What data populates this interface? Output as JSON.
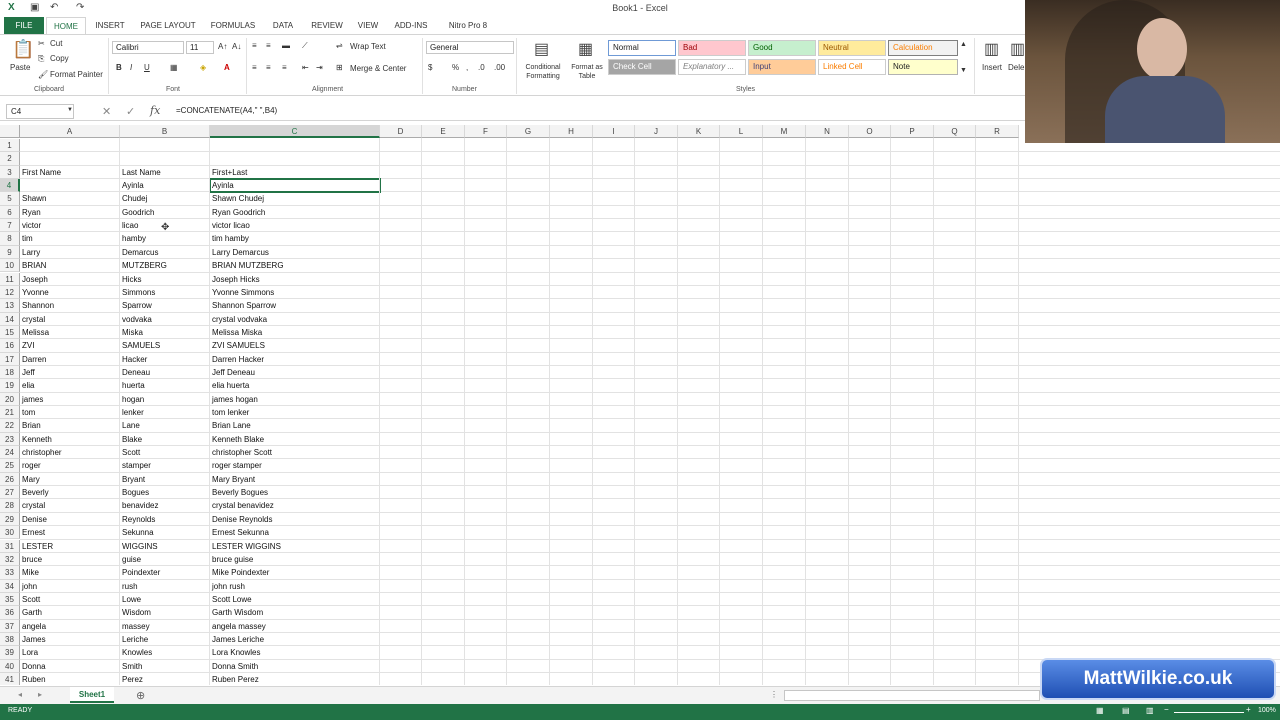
{
  "window": {
    "title": "Book1 - Excel"
  },
  "qat": {
    "excel_icon": "excel-icon",
    "save_icon": "save-icon",
    "undo_icon": "undo-icon",
    "redo_icon": "redo-icon"
  },
  "tabs": [
    "FILE",
    "HOME",
    "INSERT",
    "PAGE LAYOUT",
    "FORMULAS",
    "DATA",
    "REVIEW",
    "VIEW",
    "ADD-INS",
    "Nitro Pro 8"
  ],
  "ribbon": {
    "clipboard": {
      "paste": "Paste",
      "cut": "Cut",
      "copy": "Copy",
      "format_painter": "Format Painter",
      "label": "Clipboard"
    },
    "font": {
      "name": "Calibri",
      "size": "11",
      "bold": "B",
      "italic": "I",
      "underline": "U",
      "label": "Font"
    },
    "alignment": {
      "wrap_text": "Wrap Text",
      "merge_center": "Merge & Center",
      "label": "Alignment"
    },
    "number": {
      "format": "General",
      "percent": "%",
      "label": "Number"
    },
    "styles": {
      "conditional": "Conditional Formatting",
      "format_as_table": "Format as Table",
      "cells": [
        "Normal",
        "Bad",
        "Good",
        "Neutral",
        "Calculation",
        "Check Cell",
        "Explanatory ...",
        "Input",
        "Linked Cell",
        "Note"
      ],
      "label": "Styles"
    },
    "cells_group": {
      "insert": "Insert",
      "delete": "Dele"
    }
  },
  "formula_bar": {
    "name_box": "C4",
    "cancel": "✕",
    "enter": "✓",
    "fx": "fx",
    "formula": "=CONCATENATE(A4,\" \",B4)"
  },
  "columns": [
    "A",
    "B",
    "C",
    "D",
    "E",
    "F",
    "G",
    "H",
    "I",
    "J",
    "K",
    "L",
    "M",
    "N",
    "O",
    "P",
    "Q",
    "R"
  ],
  "rows": [
    {
      "n": "1",
      "a": "",
      "b": "",
      "c": ""
    },
    {
      "n": "2",
      "a": "",
      "b": "",
      "c": ""
    },
    {
      "n": "3",
      "a": "First Name",
      "b": "Last Name",
      "c": "First+Last"
    },
    {
      "n": "4",
      "a": "",
      "b": "Ayinla",
      "c": " Ayinla"
    },
    {
      "n": "5",
      "a": "Shawn",
      "b": "Chudej",
      "c": "Shawn Chudej"
    },
    {
      "n": "6",
      "a": "Ryan",
      "b": "Goodrich",
      "c": "Ryan Goodrich"
    },
    {
      "n": "7",
      "a": "victor",
      "b": "licao",
      "c": "victor licao"
    },
    {
      "n": "8",
      "a": "tim",
      "b": "hamby",
      "c": "tim hamby"
    },
    {
      "n": "9",
      "a": "Larry",
      "b": "Demarcus",
      "c": "Larry Demarcus"
    },
    {
      "n": "10",
      "a": "BRIAN",
      "b": "MUTZBERG",
      "c": "BRIAN MUTZBERG"
    },
    {
      "n": "11",
      "a": "Joseph",
      "b": "Hicks",
      "c": "Joseph Hicks"
    },
    {
      "n": "12",
      "a": "Yvonne",
      "b": "Simmons",
      "c": "Yvonne Simmons"
    },
    {
      "n": "13",
      "a": "Shannon",
      "b": "Sparrow",
      "c": "Shannon Sparrow"
    },
    {
      "n": "14",
      "a": "crystal",
      "b": "vodvaka",
      "c": "crystal vodvaka"
    },
    {
      "n": "15",
      "a": "Melissa",
      "b": "Miska",
      "c": "Melissa Miska"
    },
    {
      "n": "16",
      "a": "ZVI",
      "b": "SAMUELS",
      "c": "ZVI SAMUELS"
    },
    {
      "n": "17",
      "a": "Darren",
      "b": "Hacker",
      "c": "Darren Hacker"
    },
    {
      "n": "18",
      "a": "Jeff",
      "b": "Deneau",
      "c": "Jeff Deneau"
    },
    {
      "n": "19",
      "a": "elia",
      "b": "huerta",
      "c": "elia huerta"
    },
    {
      "n": "20",
      "a": "james",
      "b": "hogan",
      "c": "james hogan"
    },
    {
      "n": "21",
      "a": "tom",
      "b": "lenker",
      "c": "tom lenker"
    },
    {
      "n": "22",
      "a": "Brian",
      "b": "Lane",
      "c": "Brian Lane"
    },
    {
      "n": "23",
      "a": "Kenneth",
      "b": "Blake",
      "c": "Kenneth Blake"
    },
    {
      "n": "24",
      "a": "christopher",
      "b": "Scott",
      "c": "christopher Scott"
    },
    {
      "n": "25",
      "a": "roger",
      "b": "stamper",
      "c": "roger stamper"
    },
    {
      "n": "26",
      "a": "Mary",
      "b": "Bryant",
      "c": "Mary Bryant"
    },
    {
      "n": "27",
      "a": "Beverly",
      "b": "Bogues",
      "c": "Beverly Bogues"
    },
    {
      "n": "28",
      "a": "crystal",
      "b": "benavidez",
      "c": "crystal benavidez"
    },
    {
      "n": "29",
      "a": "Denise",
      "b": "Reynolds",
      "c": "Denise Reynolds"
    },
    {
      "n": "30",
      "a": "Ernest",
      "b": "Sekunna",
      "c": "Ernest Sekunna"
    },
    {
      "n": "31",
      "a": "LESTER",
      "b": "WIGGINS",
      "c": "LESTER WIGGINS"
    },
    {
      "n": "32",
      "a": "bruce",
      "b": "guise",
      "c": "bruce guise"
    },
    {
      "n": "33",
      "a": "Mike",
      "b": "Poindexter",
      "c": "Mike Poindexter"
    },
    {
      "n": "34",
      "a": "john",
      "b": "rush",
      "c": "john rush"
    },
    {
      "n": "35",
      "a": "Scott",
      "b": "Lowe",
      "c": "Scott Lowe"
    },
    {
      "n": "36",
      "a": "Garth",
      "b": "Wisdom",
      "c": "Garth Wisdom"
    },
    {
      "n": "37",
      "a": "angela",
      "b": "massey",
      "c": "angela massey"
    },
    {
      "n": "38",
      "a": "James",
      "b": "Leriche",
      "c": "James Leriche"
    },
    {
      "n": "39",
      "a": "Lora",
      "b": "Knowles",
      "c": "Lora Knowles"
    },
    {
      "n": "40",
      "a": "Donna",
      "b": "Smith",
      "c": "Donna Smith"
    },
    {
      "n": "41",
      "a": "Ruben",
      "b": "Perez",
      "c": "Ruben Perez"
    }
  ],
  "sheet_tabs": [
    "Sheet1"
  ],
  "status": {
    "ready": "READY",
    "zoom": "100%"
  },
  "watermark": "MattWilkie.co.uk"
}
